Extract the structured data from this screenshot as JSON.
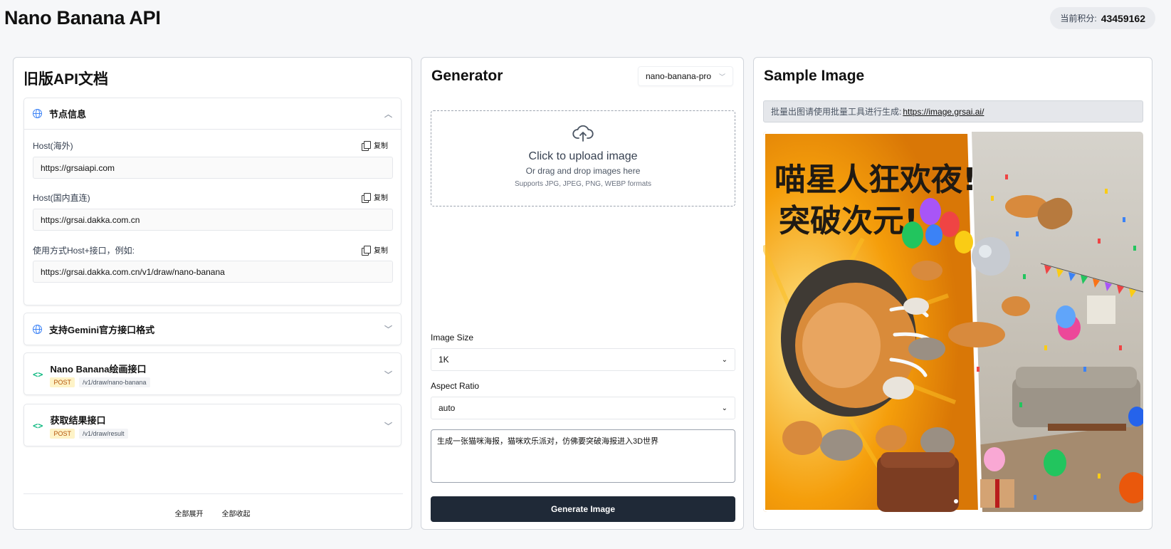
{
  "app": {
    "title": "Nano Banana API",
    "credits_label": "当前积分:",
    "credits_value": "43459162"
  },
  "docs": {
    "title": "旧版API文档",
    "node_info": {
      "title": "节点信息",
      "copy_label": "复制",
      "fields": [
        {
          "label": "Host(海外)",
          "value": "https://grsaiapi.com"
        },
        {
          "label": "Host(国内直连)",
          "value": "https://grsai.dakka.com.cn"
        },
        {
          "label": "使用方式Host+接口，例如:",
          "value": "https://grsai.dakka.com.cn/v1/draw/nano-banana"
        }
      ]
    },
    "gemini": {
      "title": "支持Gemini官方接口格式"
    },
    "endpoints": [
      {
        "title": "Nano Banana绘画接口",
        "method": "POST",
        "path": "/v1/draw/nano-banana"
      },
      {
        "title": "获取结果接口",
        "method": "POST",
        "path": "/v1/draw/result"
      }
    ],
    "expand_all": "全部展开",
    "collapse_all": "全部收起"
  },
  "generator": {
    "title": "Generator",
    "model": "nano-banana-pro",
    "upload": {
      "title": "Click to upload image",
      "subtitle": "Or drag and drop images here",
      "hint": "Supports JPG, JPEG, PNG, WEBP formats"
    },
    "image_size_label": "Image Size",
    "image_size_value": "1K",
    "aspect_ratio_label": "Aspect Ratio",
    "aspect_ratio_value": "auto",
    "prompt": "生成一张猫咪海报，猫咪欢乐派对，仿佛要突破海报进入3D世界",
    "generate_label": "Generate Image"
  },
  "sample": {
    "title": "Sample Image",
    "notice_text": "批量出图请使用批量工具进行生成:",
    "notice_link": "https://image.grsai.ai/",
    "poster_line1": "喵星人狂欢夜!",
    "poster_line2": "突破次元!"
  }
}
